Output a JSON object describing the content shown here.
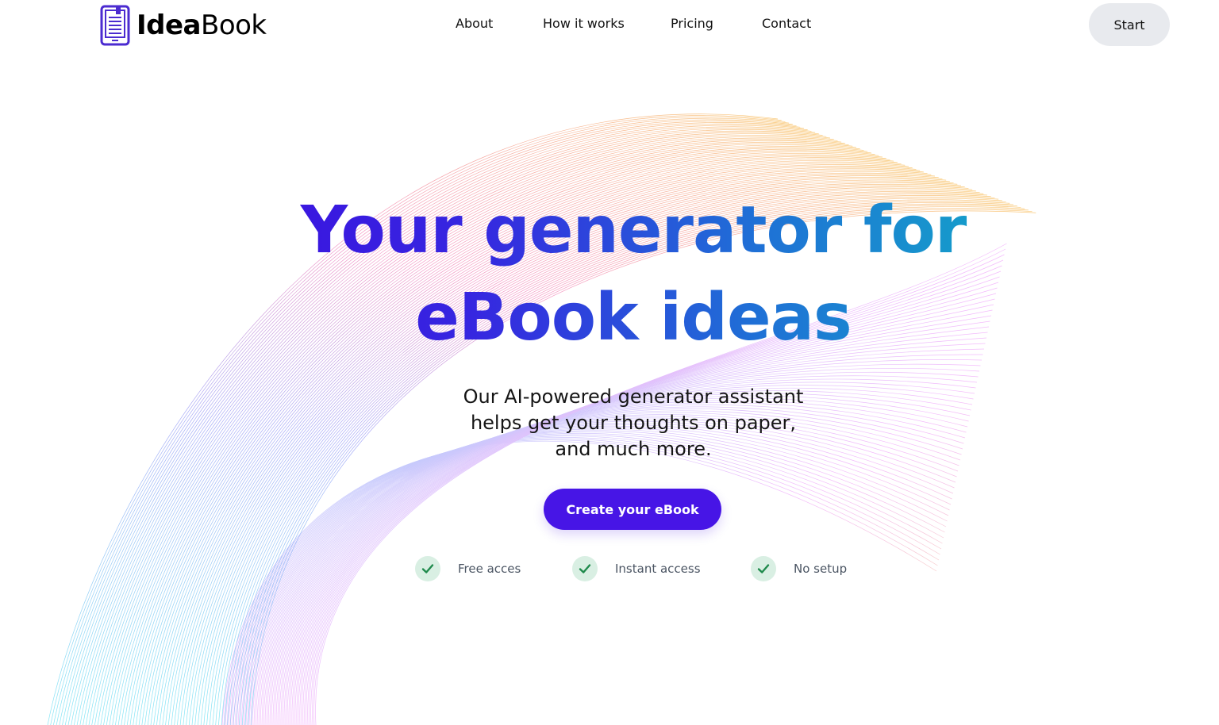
{
  "brand": {
    "name_bold": "Idea",
    "name_light": "Book",
    "icon": "ebook-icon",
    "icon_color": "#4b2bd0"
  },
  "nav": {
    "links": [
      {
        "label": "About"
      },
      {
        "label": "How it works"
      },
      {
        "label": "Pricing"
      },
      {
        "label": "Contact"
      }
    ],
    "start_label": "Start"
  },
  "hero": {
    "headline_line1": "Your generator for",
    "headline_line2": "eBook ideas",
    "subtitle": "Our AI-powered generator assistant helps get your thoughts on paper, and much more.",
    "cta_label": "Create your eBook",
    "features": [
      {
        "label": "Free acces",
        "icon": "check-icon"
      },
      {
        "label": "Instant access",
        "icon": "check-icon"
      },
      {
        "label": "No setup",
        "icon": "check-icon"
      }
    ]
  },
  "colors": {
    "accent": "#4715e6",
    "headline_gradient_start": "#3b12e0",
    "headline_gradient_end": "#13a7c8",
    "check_bg": "#d9efe3",
    "check_color": "#1f8a4c",
    "start_bg": "#e8eaee"
  }
}
